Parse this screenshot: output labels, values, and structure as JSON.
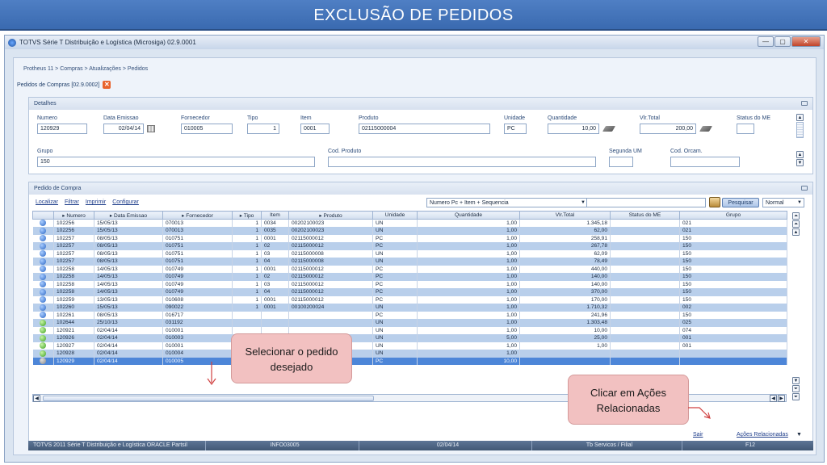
{
  "banner": {
    "title": "EXCLUSÃO DE PEDIDOS"
  },
  "window": {
    "title": "TOTVS Série T Distribuição e Logística (Microsiga) 02.9.0001",
    "minimize": "—",
    "maximize": "▢",
    "close": "✕"
  },
  "breadcrumb": "Protheus 11 > Compras  > Atualizações > Pedidos",
  "doc_tab": {
    "label": "Pedidos de Compras [02.9.0002]",
    "close": "✕"
  },
  "details": {
    "header": "Detalhes",
    "fields": {
      "numero": {
        "label": "Numero",
        "value": "120929"
      },
      "data_emissao": {
        "label": "Data Emissao",
        "value": "02/04/14"
      },
      "fornecedor": {
        "label": "Fornecedor",
        "value": "010005"
      },
      "tipo": {
        "label": "Tipo",
        "value": "1"
      },
      "item": {
        "label": "Item",
        "value": "0001"
      },
      "produto": {
        "label": "Produto",
        "value": "02115000004"
      },
      "unidade": {
        "label": "Unidade",
        "value": "PC"
      },
      "quantidade": {
        "label": "Quantidade",
        "value": "10,00"
      },
      "vlr_total": {
        "label": "Vlr.Total",
        "value": "200,00"
      },
      "status_me": {
        "label": "Status do ME",
        "value": ""
      },
      "grupo": {
        "label": "Grupo",
        "value": "150"
      },
      "cod_produto": {
        "label": "Cod. Produto",
        "value": ""
      },
      "segunda_um": {
        "label": "Segunda UM",
        "value": ""
      },
      "cod_orcam": {
        "label": "Cod. Orcam.",
        "value": ""
      }
    }
  },
  "grid_panel": {
    "header": "Pedido de Compra",
    "links": [
      "Localizar",
      "Filtrar",
      "Imprimir",
      "Configurar"
    ],
    "index_select": "Numero Pc + Item + Sequencia",
    "search_value": "",
    "search_button": "Pesquisar",
    "mode_select": "Normal",
    "columns": [
      "",
      "▸ Numero",
      "▸ Data Emissao",
      "▸ Fornecedor",
      "▸ Tipo",
      "Item",
      "▸ Produto",
      "Unidade",
      "Quantidade",
      "Vlr.Total",
      "Status do ME",
      "Grupo"
    ],
    "rows": [
      {
        "status": "blue",
        "numero": "102256",
        "data": "15/05/13",
        "forn": "070013",
        "tipo": "1",
        "item": "0034",
        "prod": "00202100023",
        "un": "UN",
        "qtd": "1,00",
        "total": "1.345,18",
        "st": "",
        "grupo": "021"
      },
      {
        "status": "blue",
        "numero": "102256",
        "data": "15/05/13",
        "forn": "070013",
        "tipo": "1",
        "item": "0035",
        "prod": "00202100023",
        "un": "UN",
        "qtd": "1,00",
        "total": "62,00",
        "st": "",
        "grupo": "021"
      },
      {
        "status": "blue",
        "numero": "102257",
        "data": "08/05/13",
        "forn": "010751",
        "tipo": "1",
        "item": "0001",
        "prod": "02115000012",
        "un": "PC",
        "qtd": "1,00",
        "total": "258,91",
        "st": "",
        "grupo": "150"
      },
      {
        "status": "blue",
        "numero": "102257",
        "data": "08/05/13",
        "forn": "010751",
        "tipo": "1",
        "item": "02",
        "prod": "02115000012",
        "un": "PC",
        "qtd": "1,00",
        "total": "267,78",
        "st": "",
        "grupo": "150"
      },
      {
        "status": "blue",
        "numero": "102257",
        "data": "08/05/13",
        "forn": "010751",
        "tipo": "1",
        "item": "03",
        "prod": "02115000008",
        "un": "UN",
        "qtd": "1,00",
        "total": "62,09",
        "st": "",
        "grupo": "150"
      },
      {
        "status": "blue",
        "numero": "102257",
        "data": "08/05/13",
        "forn": "010751",
        "tipo": "1",
        "item": "04",
        "prod": "02115000008",
        "un": "UN",
        "qtd": "1,00",
        "total": "78,49",
        "st": "",
        "grupo": "150"
      },
      {
        "status": "blue",
        "numero": "102258",
        "data": "14/05/13",
        "forn": "010749",
        "tipo": "1",
        "item": "0001",
        "prod": "02115000012",
        "un": "PC",
        "qtd": "1,00",
        "total": "440,00",
        "st": "",
        "grupo": "150"
      },
      {
        "status": "blue",
        "numero": "102258",
        "data": "14/05/13",
        "forn": "010749",
        "tipo": "1",
        "item": "02",
        "prod": "02115000012",
        "un": "PC",
        "qtd": "1,00",
        "total": "140,00",
        "st": "",
        "grupo": "150"
      },
      {
        "status": "blue",
        "numero": "102258",
        "data": "14/05/13",
        "forn": "010749",
        "tipo": "1",
        "item": "03",
        "prod": "02115000012",
        "un": "PC",
        "qtd": "1,00",
        "total": "140,00",
        "st": "",
        "grupo": "150"
      },
      {
        "status": "blue",
        "numero": "102258",
        "data": "14/05/13",
        "forn": "010749",
        "tipo": "1",
        "item": "04",
        "prod": "02115000012",
        "un": "PC",
        "qtd": "1,00",
        "total": "370,00",
        "st": "",
        "grupo": "150"
      },
      {
        "status": "blue",
        "numero": "102259",
        "data": "13/05/13",
        "forn": "010608",
        "tipo": "1",
        "item": "0001",
        "prod": "02115000012",
        "un": "PC",
        "qtd": "1,00",
        "total": "170,00",
        "st": "",
        "grupo": "150"
      },
      {
        "status": "blue",
        "numero": "102260",
        "data": "15/05/13",
        "forn": "090022",
        "tipo": "1",
        "item": "0001",
        "prod": "00100200024",
        "un": "UN",
        "qtd": "1,00",
        "total": "1.710,32",
        "st": "",
        "grupo": "002"
      },
      {
        "status": "blue",
        "numero": "102261",
        "data": "08/05/13",
        "forn": "016717",
        "tipo": "",
        "item": "",
        "prod": "",
        "un": "PC",
        "qtd": "1,00",
        "total": "241,96",
        "st": "",
        "grupo": "150"
      },
      {
        "status": "green",
        "numero": "102644",
        "data": "25/10/13",
        "forn": "031192",
        "tipo": "",
        "item": "",
        "prod": "",
        "un": "UN",
        "qtd": "1,00",
        "total": "1.303,48",
        "st": "",
        "grupo": "025"
      },
      {
        "status": "green",
        "numero": "120921",
        "data": "02/04/14",
        "forn": "010001",
        "tipo": "",
        "item": "",
        "prod": "",
        "un": "UN",
        "qtd": "1,00",
        "total": "10,00",
        "st": "",
        "grupo": "074"
      },
      {
        "status": "green",
        "numero": "120926",
        "data": "02/04/14",
        "forn": "010003",
        "tipo": "",
        "item": "",
        "prod": "",
        "un": "UN",
        "qtd": "5,00",
        "total": "25,00",
        "st": "",
        "grupo": "001"
      },
      {
        "status": "green",
        "numero": "120927",
        "data": "02/04/14",
        "forn": "010001",
        "tipo": "",
        "item": "",
        "prod": "",
        "un": "UN",
        "qtd": "1,00",
        "total": "1,00",
        "st": "",
        "grupo": "001"
      },
      {
        "status": "green",
        "numero": "120928",
        "data": "02/04/14",
        "forn": "010004",
        "tipo": "",
        "item": "",
        "prod": "",
        "un": "UN",
        "qtd": "1,00",
        "total": "",
        "st": "",
        "grupo": ""
      },
      {
        "status": "gray",
        "numero": "120929",
        "data": "02/04/14",
        "forn": "010005",
        "tipo": "1",
        "item": "0001",
        "prod": "02115000004",
        "un": "PC",
        "qtd": "10,00",
        "total": "",
        "st": "",
        "grupo": ""
      }
    ]
  },
  "actions": {
    "sair": "Sair",
    "acoes": "Ações Relacionadas"
  },
  "callouts": {
    "select": "Selecionar o pedido desejado",
    "actions": "Clicar em Ações Relacionadas"
  },
  "statusbar": [
    "TOTVS 2011 Série T Distribuição e Logística ORACLE Partsil",
    "INFO03005",
    "02/04/14",
    "Tb Servicos / Filial",
    "F12"
  ],
  "colors": {
    "selected_row": "#4d86d8",
    "alt_row": "#b9cfeb",
    "callout": "#f2c1c1",
    "banner": "#3a6ab0"
  }
}
